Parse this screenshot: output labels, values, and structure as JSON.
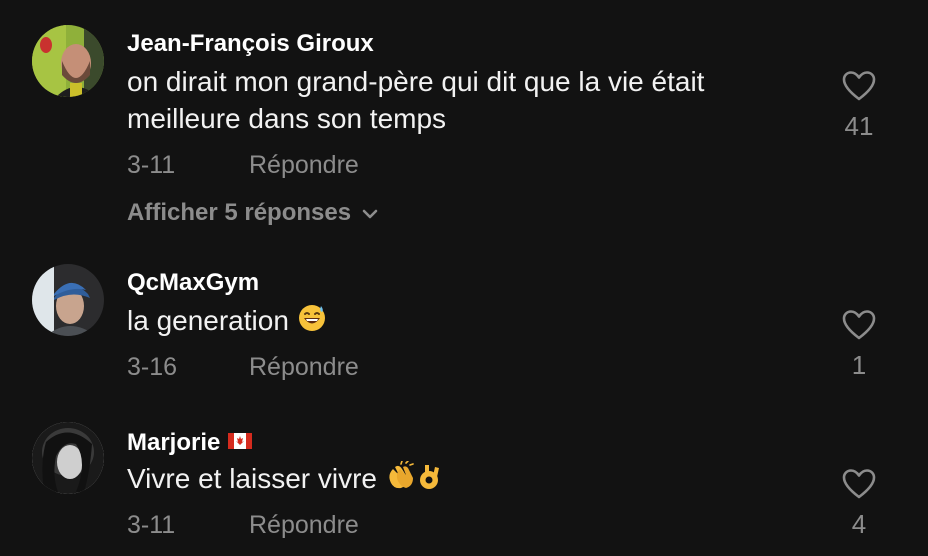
{
  "comments": [
    {
      "username": "Jean-François Giroux",
      "text": "on dirait mon grand-père qui dit que la vie était meilleure dans son temps",
      "date": "3-11",
      "reply_label": "Répondre",
      "likes": "41",
      "view_replies_label": "Afficher 5 réponses"
    },
    {
      "username": "QcMaxGym",
      "text": "la generation",
      "emoji": "grinning-sweat-emoji",
      "date": "3-16",
      "reply_label": "Répondre",
      "likes": "1"
    },
    {
      "username": "Marjorie",
      "flag": "canada-flag-icon",
      "text": "Vivre et laisser vivre",
      "emoji": "clapping-hands-ok-hand-emoji",
      "date": "3-11",
      "reply_label": "Répondre",
      "likes": "4"
    }
  ],
  "colors": {
    "background": "#121212",
    "primary_text": "#ffffff",
    "secondary_text": "#8c8c8c"
  }
}
